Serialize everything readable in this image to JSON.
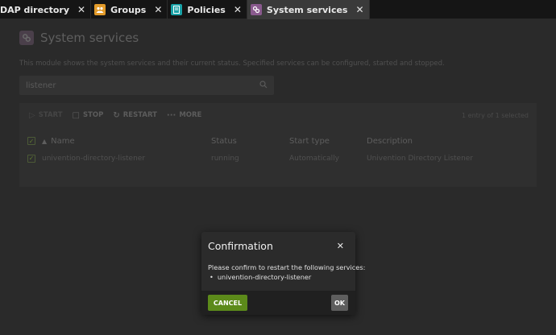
{
  "tabs": [
    {
      "label": "DAP directory",
      "icon": "directory-icon",
      "active": false
    },
    {
      "label": "Groups",
      "icon": "groups-icon",
      "color": "#e39b2a",
      "active": false
    },
    {
      "label": "Policies",
      "icon": "policies-icon",
      "color": "#1aa3a8",
      "active": false
    },
    {
      "label": "System services",
      "icon": "services-icon",
      "color": "#8a5a8e",
      "active": true
    }
  ],
  "module": {
    "title": "System services",
    "description": "This module shows the system services and their current status. Specified services can be configured, started and stopped.",
    "search_value": "listener",
    "toolbar": {
      "start": "START",
      "stop": "STOP",
      "restart": "RESTART",
      "more": "MORE",
      "selection_status": "1 entry of 1 selected"
    },
    "columns": {
      "name": "Name",
      "status": "Status",
      "start_type": "Start type",
      "description": "Description"
    },
    "rows": [
      {
        "name": "univention-directory-listener",
        "status": "running",
        "start_type": "Automatically",
        "description": "Univention Directory Listener"
      }
    ]
  },
  "dialog": {
    "title": "Confirmation",
    "message": "Please confirm to restart the following services:",
    "items": [
      "univention-directory-listener"
    ],
    "cancel_label": "CANCEL",
    "ok_label": "OK"
  },
  "colors": {
    "accent_green": "#5c8a1a",
    "dialog_bg": "#2b2b2b"
  }
}
